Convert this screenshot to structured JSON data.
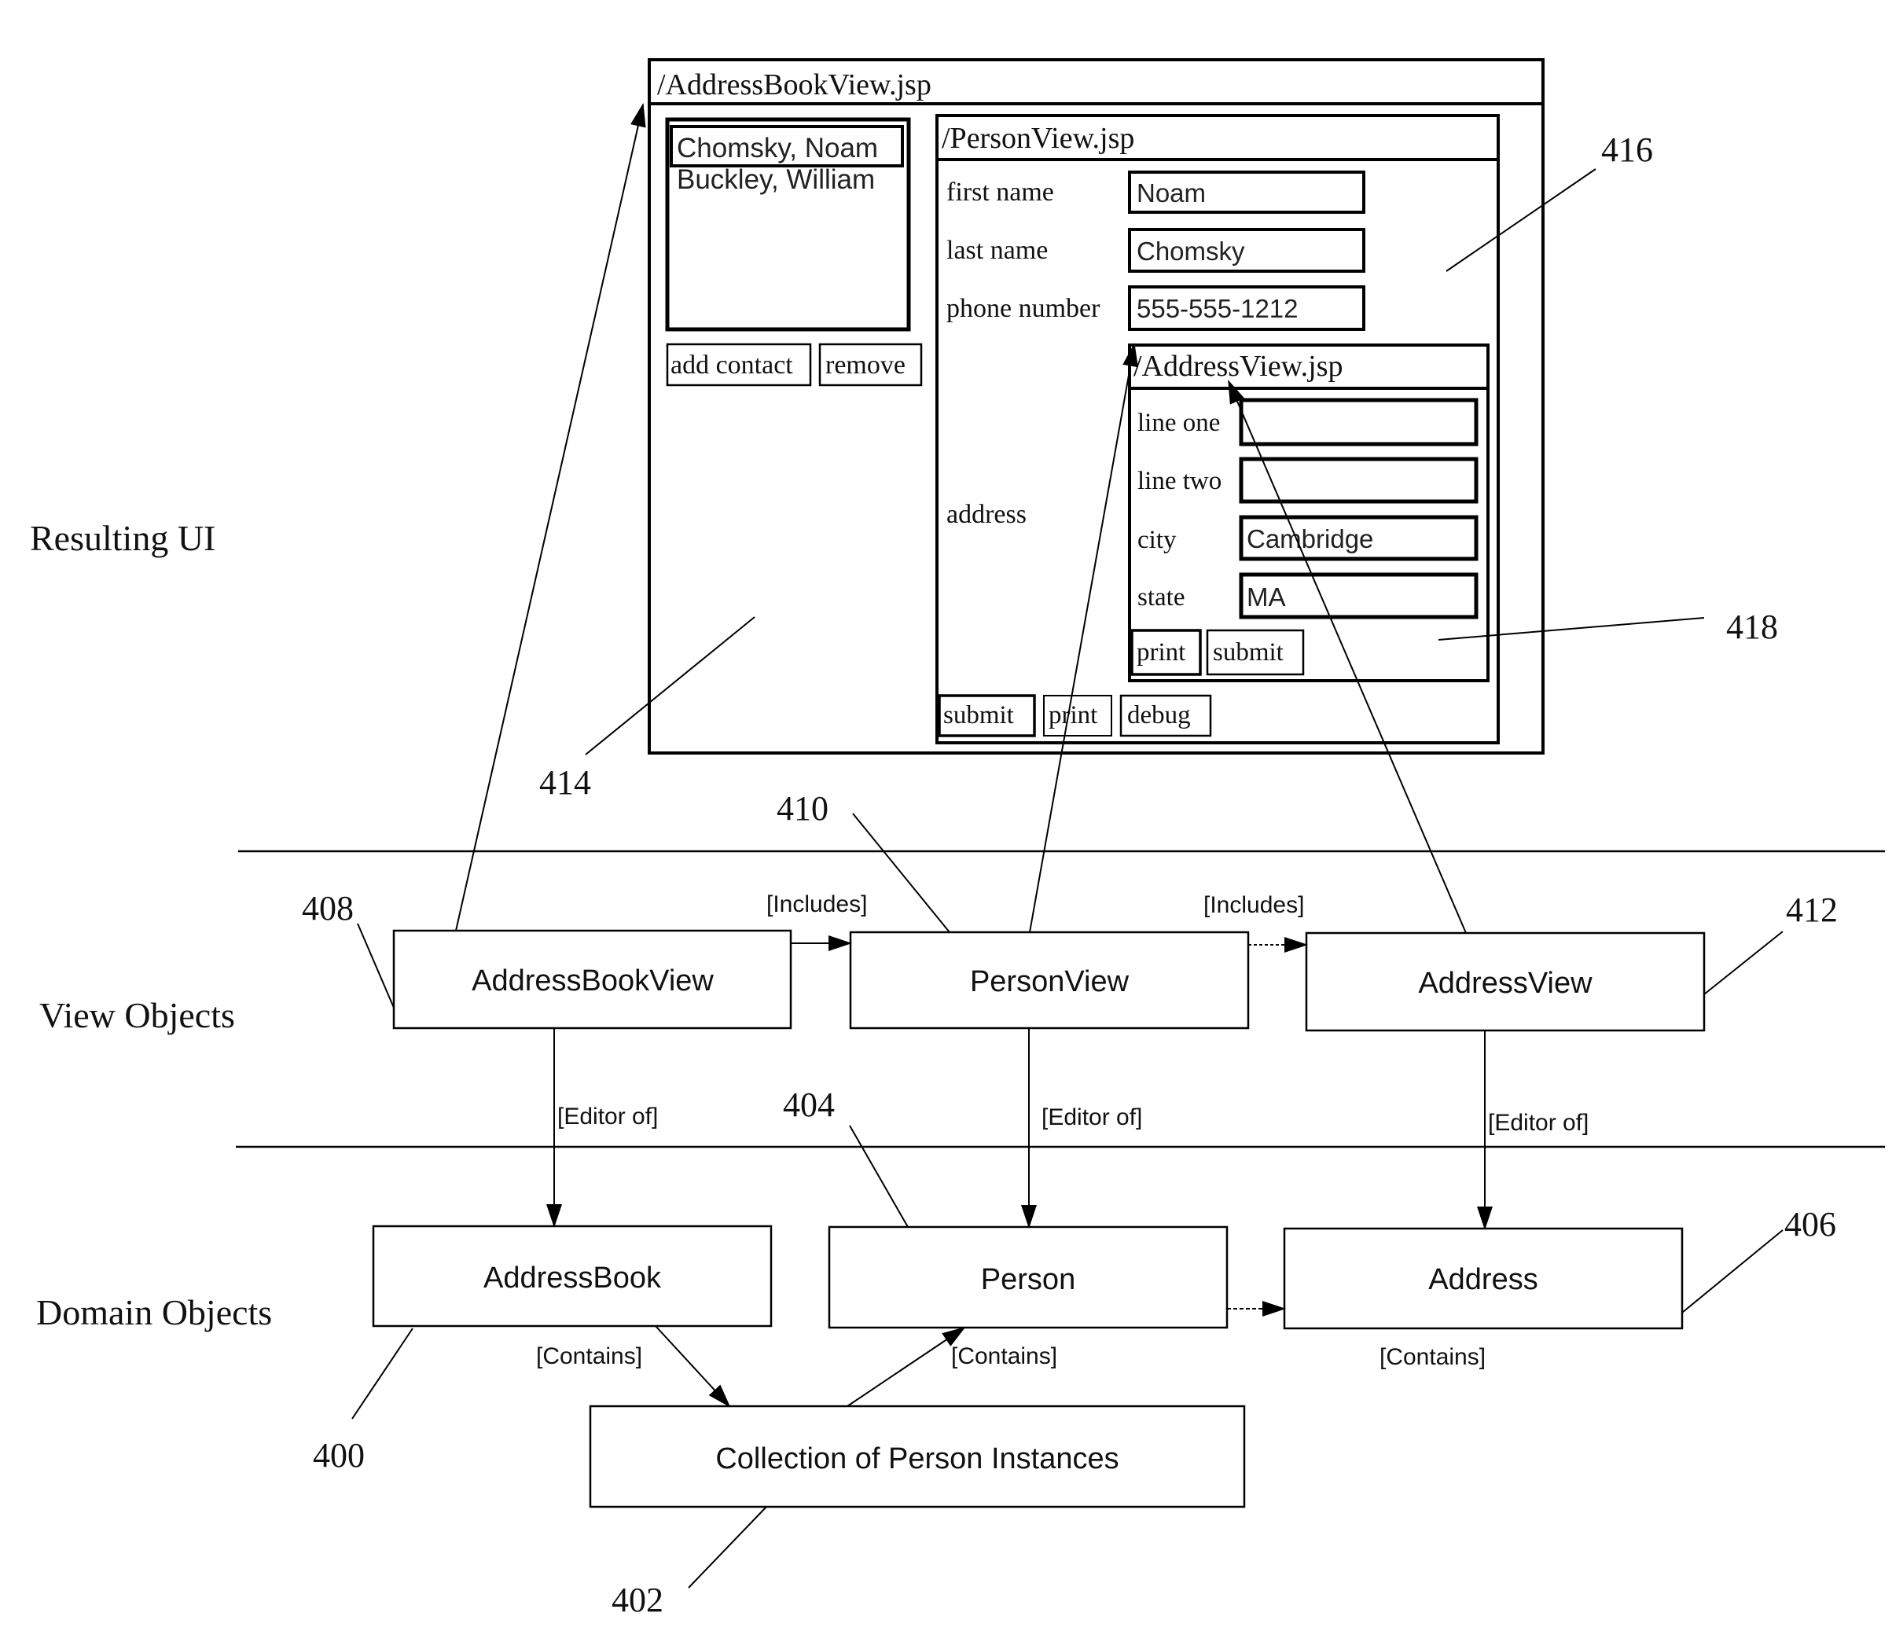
{
  "sections": {
    "resulting_ui": "Resulting UI",
    "view_objects": "View Objects",
    "domain_objects": "Domain Objects"
  },
  "mock_ui": {
    "address_book_view": {
      "title": "/AddressBookView.jsp",
      "contacts": [
        {
          "name": "Chomsky, Noam",
          "selected": true
        },
        {
          "name": "Buckley, William",
          "selected": false
        }
      ],
      "buttons": {
        "add_contact": "add contact",
        "remove": "remove"
      }
    },
    "person_view": {
      "title": "/PersonView.jsp",
      "fields": [
        {
          "label": "first name",
          "value": "Noam"
        },
        {
          "label": "last name",
          "value": "Chomsky"
        },
        {
          "label": "phone number",
          "value": "555-555-1212"
        }
      ],
      "address_label": "address",
      "buttons": {
        "submit": "submit",
        "print": "print",
        "debug": "debug"
      }
    },
    "address_view": {
      "title": "/AddressView.jsp",
      "fields": [
        {
          "label": "line one",
          "value": ""
        },
        {
          "label": "line two",
          "value": ""
        },
        {
          "label": "city",
          "value": "Cambridge"
        },
        {
          "label": "state",
          "value": "MA"
        }
      ],
      "buttons": {
        "print": "print",
        "submit": "submit"
      }
    }
  },
  "view_objects": [
    {
      "name": "AddressBookView",
      "ref": "408"
    },
    {
      "name": "PersonView",
      "ref": "410"
    },
    {
      "name": "AddressView",
      "ref": "412"
    }
  ],
  "domain_objects": [
    {
      "name": "AddressBook",
      "ref": "400"
    },
    {
      "name": "Person",
      "ref": "404"
    },
    {
      "name": "Address",
      "ref": "406"
    },
    {
      "name": "Collection of Person Instances",
      "ref": "402"
    }
  ],
  "relations": {
    "includes_1": "[Includes]",
    "includes_2": "[Includes]",
    "editor_of_1": "[Editor of]",
    "editor_of_2": "[Editor of]",
    "editor_of_3": "[Editor of]",
    "contains_1": "[Contains]",
    "contains_2": "[Contains]",
    "contains_3": "[Contains]"
  },
  "ui_refs": {
    "address_book_panel": "414",
    "person_panel": "416",
    "address_panel": "418"
  }
}
